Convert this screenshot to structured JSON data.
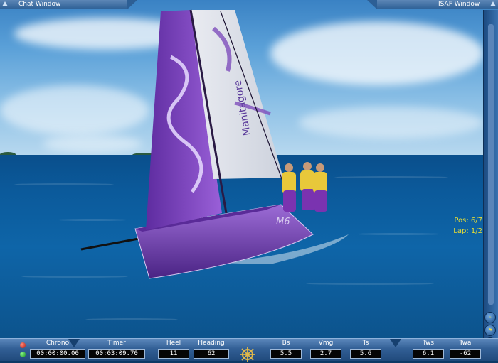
{
  "windows": {
    "chat_title": "Chat Window",
    "isaf_title": "ISAF Window"
  },
  "race": {
    "pos_label": "Pos: 6/7",
    "lap_label": "Lap: 1/2"
  },
  "boat": {
    "sail_brand": "Manitagore",
    "hull_label": "M6",
    "hull_color": "#7a3fb0",
    "sail_color": "#7f45c4",
    "crew_jacket": "#e8c83a"
  },
  "instruments": [
    {
      "id": "chrono",
      "label": "Chrono",
      "value": "00:00:00.00"
    },
    {
      "id": "timer",
      "label": "Timer",
      "value": "00:03:09.70"
    },
    {
      "id": "heel",
      "label": "Heel",
      "value": "11"
    },
    {
      "id": "heading",
      "label": "Heading",
      "value": "62"
    },
    {
      "id": "bs",
      "label": "Bs",
      "value": "5.5"
    },
    {
      "id": "vmg",
      "label": "Vmg",
      "value": "2.7"
    },
    {
      "id": "ts",
      "label": "Ts",
      "value": "5.6"
    },
    {
      "id": "tws",
      "label": "Tws",
      "value": "6.1"
    },
    {
      "id": "twa",
      "label": "Twa",
      "value": "-62"
    }
  ],
  "status_lights": {
    "red": "#d4251a",
    "green": "#1fb52a"
  },
  "icons": {
    "helm": "ship-wheel-icon",
    "zoom": "magnifier-icon",
    "wind": "windsock-icon"
  },
  "colors": {
    "hud_accent": "#e6dd35",
    "panel": "#2d5f95"
  }
}
